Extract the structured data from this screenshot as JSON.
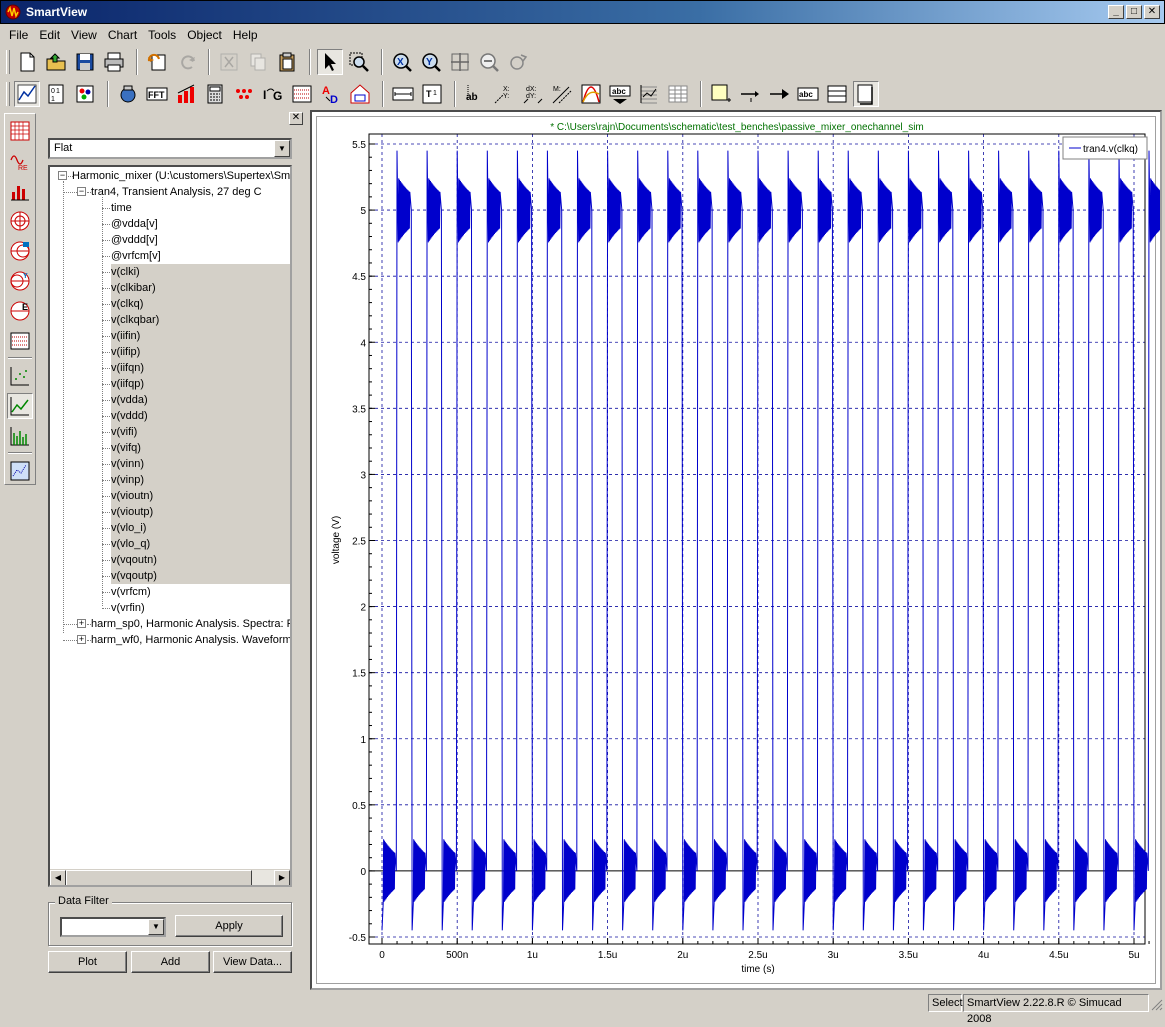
{
  "window": {
    "title": "SmartView"
  },
  "menu": [
    "File",
    "Edit",
    "View",
    "Chart",
    "Tools",
    "Object",
    "Help"
  ],
  "toolbar_row1": [
    "new-file-icon",
    "open-icon",
    "save-icon",
    "print-icon",
    "undo-icon",
    "redo-icon",
    "cut-icon",
    "copy-icon",
    "paste-icon",
    "select-arrow-icon",
    "zoom-window-icon",
    "zoom-x-icon",
    "zoom-y-icon",
    "zoom-fit-icon",
    "zoom-out-icon",
    "pan-icon"
  ],
  "toolbar_row2": [
    "line-chart-icon",
    "bin-icon",
    "palette-icon",
    "calculate-icon",
    "fft-icon",
    "bar-measure-icon",
    "calculator-icon",
    "dots-icon",
    "ic-g-icon",
    "waveform-icon",
    "ad-icon",
    "house-chart-icon",
    "h-cursor-icon",
    "t-cursor-icon",
    "ab-label-icon",
    "xy-delta-icon",
    "dx-dy-icon",
    "mxy-icon",
    "curve-icon",
    "abc-marker-icon",
    "grid-icon",
    "table-icon",
    "new-annotation-icon",
    "arrow-line-icon",
    "arrow-icon",
    "abc-text-icon",
    "list-icon",
    "frame-icon"
  ],
  "left_panel": {
    "view_mode": "Flat",
    "tree": {
      "root": "Harmonic_mixer (U:\\customers\\Supertex\\Smar",
      "analysis": "tran4, Transient Analysis, 27 deg C",
      "signals": [
        "time",
        "@vdda[v]",
        "@vddd[v]",
        "@vrfcm[v]",
        "v(clki)",
        "v(clkibar)",
        "v(clkq)",
        "v(clkqbar)",
        "v(iifin)",
        "v(iifip)",
        "v(iifqn)",
        "v(iifqp)",
        "v(vdda)",
        "v(vddd)",
        "v(vifi)",
        "v(vifq)",
        "v(vinn)",
        "v(vinp)",
        "v(vioutn)",
        "v(vioutp)",
        "v(vlo_i)",
        "v(vlo_q)",
        "v(vqoutn)",
        "v(vqoutp)",
        "v(vrfcm)",
        "v(vrfin)"
      ],
      "selected_range": [
        4,
        23
      ],
      "other_analyses": [
        "harm_sp0, Harmonic Analysis. Spectra: Fu",
        "harm_wf0, Harmonic Analysis. Waveforms:"
      ]
    },
    "data_filter": {
      "label": "Data Filter",
      "value": "",
      "apply_label": "Apply"
    },
    "buttons": {
      "plot": "Plot",
      "add": "Add",
      "view_data": "View Data..."
    }
  },
  "chart_data": {
    "type": "line",
    "title": "* C:\\Users\\rajn\\Documents\\schematic\\test_benches\\passive_mixer_onechannel_sim",
    "xlabel": "time (s)",
    "ylabel": "voltage (V)",
    "xlim": [
      0,
      5.2e-06
    ],
    "ylim": [
      -0.5,
      5.5
    ],
    "x_ticks": [
      {
        "v": 0,
        "label": "0"
      },
      {
        "v": 5e-07,
        "label": "500n"
      },
      {
        "v": 1e-06,
        "label": "1u"
      },
      {
        "v": 1.5e-06,
        "label": "1.5u"
      },
      {
        "v": 2e-06,
        "label": "2u"
      },
      {
        "v": 2.5e-06,
        "label": "2.5u"
      },
      {
        "v": 3e-06,
        "label": "3u"
      },
      {
        "v": 3.5e-06,
        "label": "3.5u"
      },
      {
        "v": 4e-06,
        "label": "4u"
      },
      {
        "v": 4.5e-06,
        "label": "4.5u"
      },
      {
        "v": 5e-06,
        "label": "5u"
      }
    ],
    "y_ticks": [
      {
        "v": -0.5,
        "label": "-0.5"
      },
      {
        "v": 0,
        "label": "0"
      },
      {
        "v": 0.5,
        "label": "0.5"
      },
      {
        "v": 1,
        "label": "1"
      },
      {
        "v": 1.5,
        "label": "1.5"
      },
      {
        "v": 2,
        "label": "2"
      },
      {
        "v": 2.5,
        "label": "2.5"
      },
      {
        "v": 3,
        "label": "3"
      },
      {
        "v": 3.5,
        "label": "3.5"
      },
      {
        "v": 4,
        "label": "4"
      },
      {
        "v": 4.5,
        "label": "4.5"
      },
      {
        "v": 5,
        "label": "5"
      },
      {
        "v": 5.5,
        "label": "5.5"
      }
    ],
    "grid": true,
    "legend_position": "top-right",
    "series": [
      {
        "name": "tran4.v(clkq)",
        "color": "#0000cc",
        "waveform": "square clock with ringing",
        "period": 2e-07,
        "high_level": 5.0,
        "low_level": 0.0,
        "peak_high": 5.45,
        "peak_low": -0.45,
        "ringing_amplitude": 0.25
      }
    ]
  },
  "status": {
    "mode": "Select",
    "version": "SmartView 2.22.8.R © Simucad 2008"
  }
}
